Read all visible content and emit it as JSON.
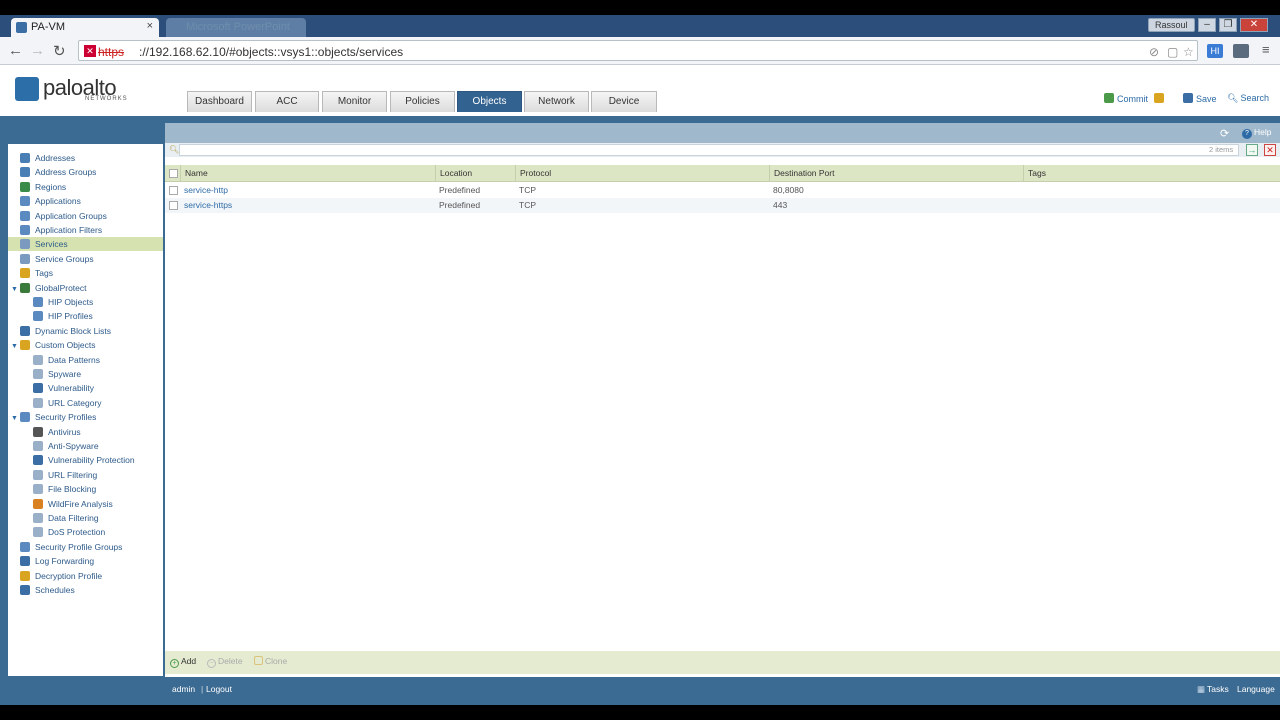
{
  "browser": {
    "tab_title": "PA-VM",
    "tab_close": "×",
    "inactive_tab_title": "Microsoft PowerPoint",
    "user": "Rassoul",
    "window_buttons": [
      "–",
      "❐",
      "✕"
    ],
    "url_scheme": "https",
    "url_rest": "://192.168.62.10/#objects::vsys1::objects/services",
    "ext_label": "HI"
  },
  "header": {
    "logo_text": "paloalto",
    "logo_sub": "NETWORKS",
    "tabs": [
      {
        "label": "Dashboard"
      },
      {
        "label": "ACC"
      },
      {
        "label": "Monitor"
      },
      {
        "label": "Policies"
      },
      {
        "label": "Objects"
      },
      {
        "label": "Network"
      },
      {
        "label": "Device"
      }
    ],
    "actions": {
      "commit": "Commit",
      "save": "Save",
      "search": "Search"
    }
  },
  "content_top": {
    "help": "Help"
  },
  "filter": {
    "placeholder": "",
    "count": "2 items"
  },
  "sidebar": {
    "items": [
      {
        "label": "Addresses"
      },
      {
        "label": "Address Groups"
      },
      {
        "label": "Regions"
      },
      {
        "label": "Applications"
      },
      {
        "label": "Application Groups"
      },
      {
        "label": "Application Filters"
      },
      {
        "label": "Services"
      },
      {
        "label": "Service Groups"
      },
      {
        "label": "Tags"
      },
      {
        "label": "GlobalProtect"
      },
      {
        "label": "HIP Objects"
      },
      {
        "label": "HIP Profiles"
      },
      {
        "label": "Dynamic Block Lists"
      },
      {
        "label": "Custom Objects"
      },
      {
        "label": "Data Patterns"
      },
      {
        "label": "Spyware"
      },
      {
        "label": "Vulnerability"
      },
      {
        "label": "URL Category"
      },
      {
        "label": "Security Profiles"
      },
      {
        "label": "Antivirus"
      },
      {
        "label": "Anti-Spyware"
      },
      {
        "label": "Vulnerability Protection"
      },
      {
        "label": "URL Filtering"
      },
      {
        "label": "File Blocking"
      },
      {
        "label": "WildFire Analysis"
      },
      {
        "label": "Data Filtering"
      },
      {
        "label": "DoS Protection"
      },
      {
        "label": "Security Profile Groups"
      },
      {
        "label": "Log Forwarding"
      },
      {
        "label": "Decryption Profile"
      },
      {
        "label": "Schedules"
      }
    ]
  },
  "grid": {
    "columns": [
      "Name",
      "Location",
      "Protocol",
      "Destination Port",
      "Tags"
    ],
    "rows": [
      {
        "name": "service-http",
        "location": "Predefined",
        "protocol": "TCP",
        "port": "80,8080",
        "tags": ""
      },
      {
        "name": "service-https",
        "location": "Predefined",
        "protocol": "TCP",
        "port": "443",
        "tags": ""
      }
    ]
  },
  "bottom": {
    "add": "Add",
    "delete": "Delete",
    "clone": "Clone"
  },
  "status": {
    "user": "admin",
    "logout": "Logout",
    "tasks": "Tasks",
    "language": "Language"
  }
}
